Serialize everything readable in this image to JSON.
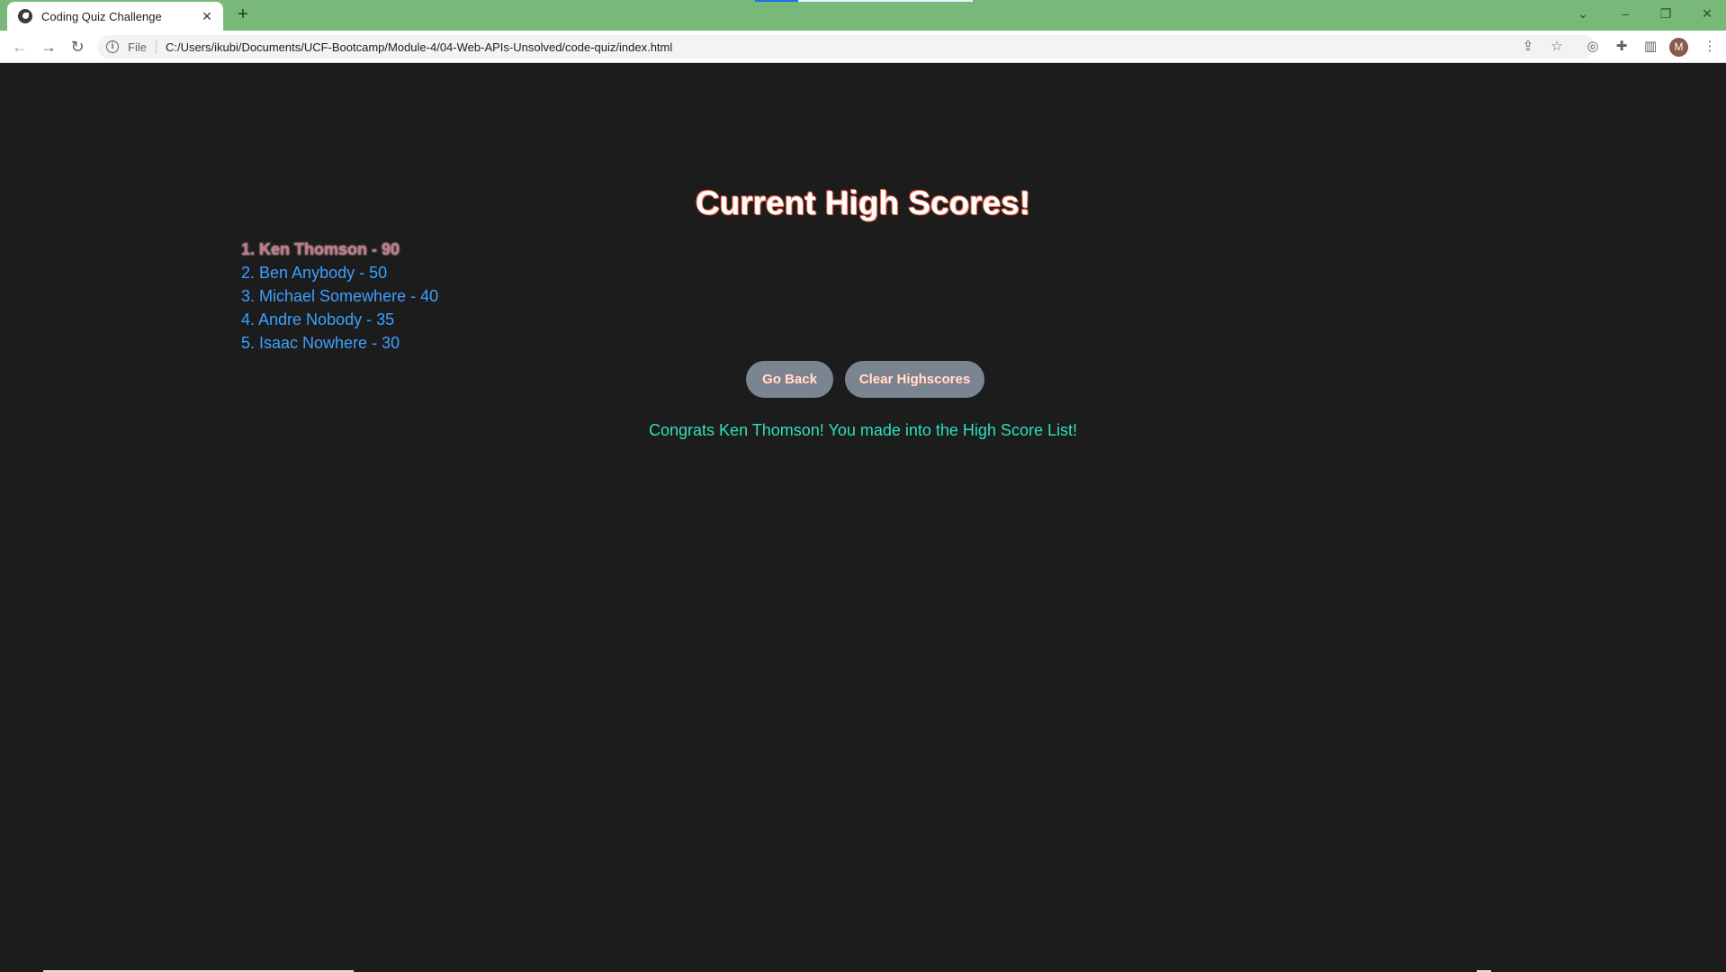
{
  "browser": {
    "tab_title": "Coding Quiz Challenge",
    "tab_close_icon": "close-icon",
    "new_tab_label": "+",
    "scheme_label": "File",
    "url": "C:/Users/ikubi/Documents/UCF-Bootcamp/Module-4/04-Web-APIs-Unsolved/code-quiz/index.html",
    "profile_initial": "M"
  },
  "main": {
    "heading": "Current High Scores!",
    "scores": [
      "1. Ken Thomson - 90",
      "2. Ben Anybody - 50",
      "3. Michael Somewhere - 40",
      "4. Andre Nobody - 35",
      "5. Isaac Nowhere - 30"
    ],
    "go_back_label": "Go Back",
    "clear_label": "Clear Highscores",
    "congrats_message": "Congrats Ken Thomson! You made into the High Score List!"
  },
  "colors": {
    "tab_strip": "#78b97a",
    "page_background": "#1c1c1c",
    "score_link": "#3da0ff",
    "congrats_text": "#2fe0b9",
    "button_background": "#7a8591"
  }
}
